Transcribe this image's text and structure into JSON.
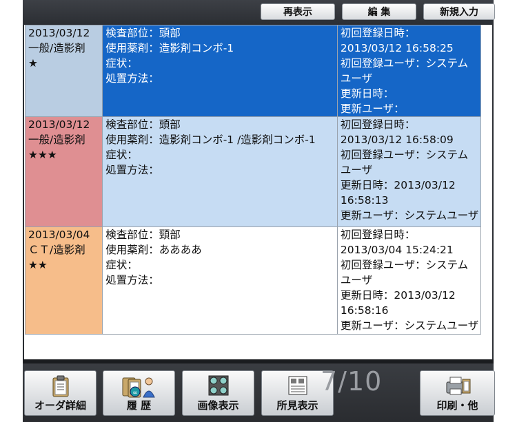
{
  "toolbar": {
    "redisplay_label": "再表示",
    "edit_label": "編 集",
    "new_label": "新規入力"
  },
  "records": [
    {
      "date": "2013/03/12",
      "category": "一般/造影剤",
      "stars": "★",
      "part": "検査部位：頭部",
      "drug": "使用薬剤：造影剤コンボ-1",
      "symptom": "症状：",
      "treatment": "処置方法：",
      "meta": [
        "初回登録日時：",
        "2013/03/12 16:58:25",
        "初回登録ユーザ：システム",
        "ユーザ",
        "更新日時：",
        "更新ユーザ："
      ]
    },
    {
      "date": "2013/03/12",
      "category": "一般/造影剤",
      "stars": "★★★",
      "part": "検査部位：頭部",
      "drug": "使用薬剤：造影剤コンボ-1 /造影剤コンボ-1",
      "symptom": "症状：",
      "treatment": "処置方法：",
      "meta": [
        "初回登録日時：",
        "2013/03/12 16:58:09",
        "初回登録ユーザ：システム",
        "ユーザ",
        "更新日時：2013/03/12",
        "16:58:13",
        "更新ユーザ：システムユーザ"
      ]
    },
    {
      "date": "2013/03/04",
      "category": "ＣＴ/造影剤",
      "stars": "★★",
      "part": "検査部位：頸部",
      "drug": "使用薬剤：ああああ",
      "symptom": "症状：",
      "treatment": "処置方法：",
      "meta": [
        "初回登録日時：",
        "2013/03/04 15:24:21",
        "初回登録ユーザ：システム",
        "ユーザ",
        "更新日時：2013/03/12",
        "16:58:16",
        "更新ユーザ：システムユーザ"
      ]
    }
  ],
  "bottom": {
    "order_detail_label": "オーダ詳細",
    "history_label": "履 歴",
    "image_label": "画像表示",
    "findings_label": "所見表示",
    "print_label": "印刷・他",
    "pager": "7/10"
  }
}
